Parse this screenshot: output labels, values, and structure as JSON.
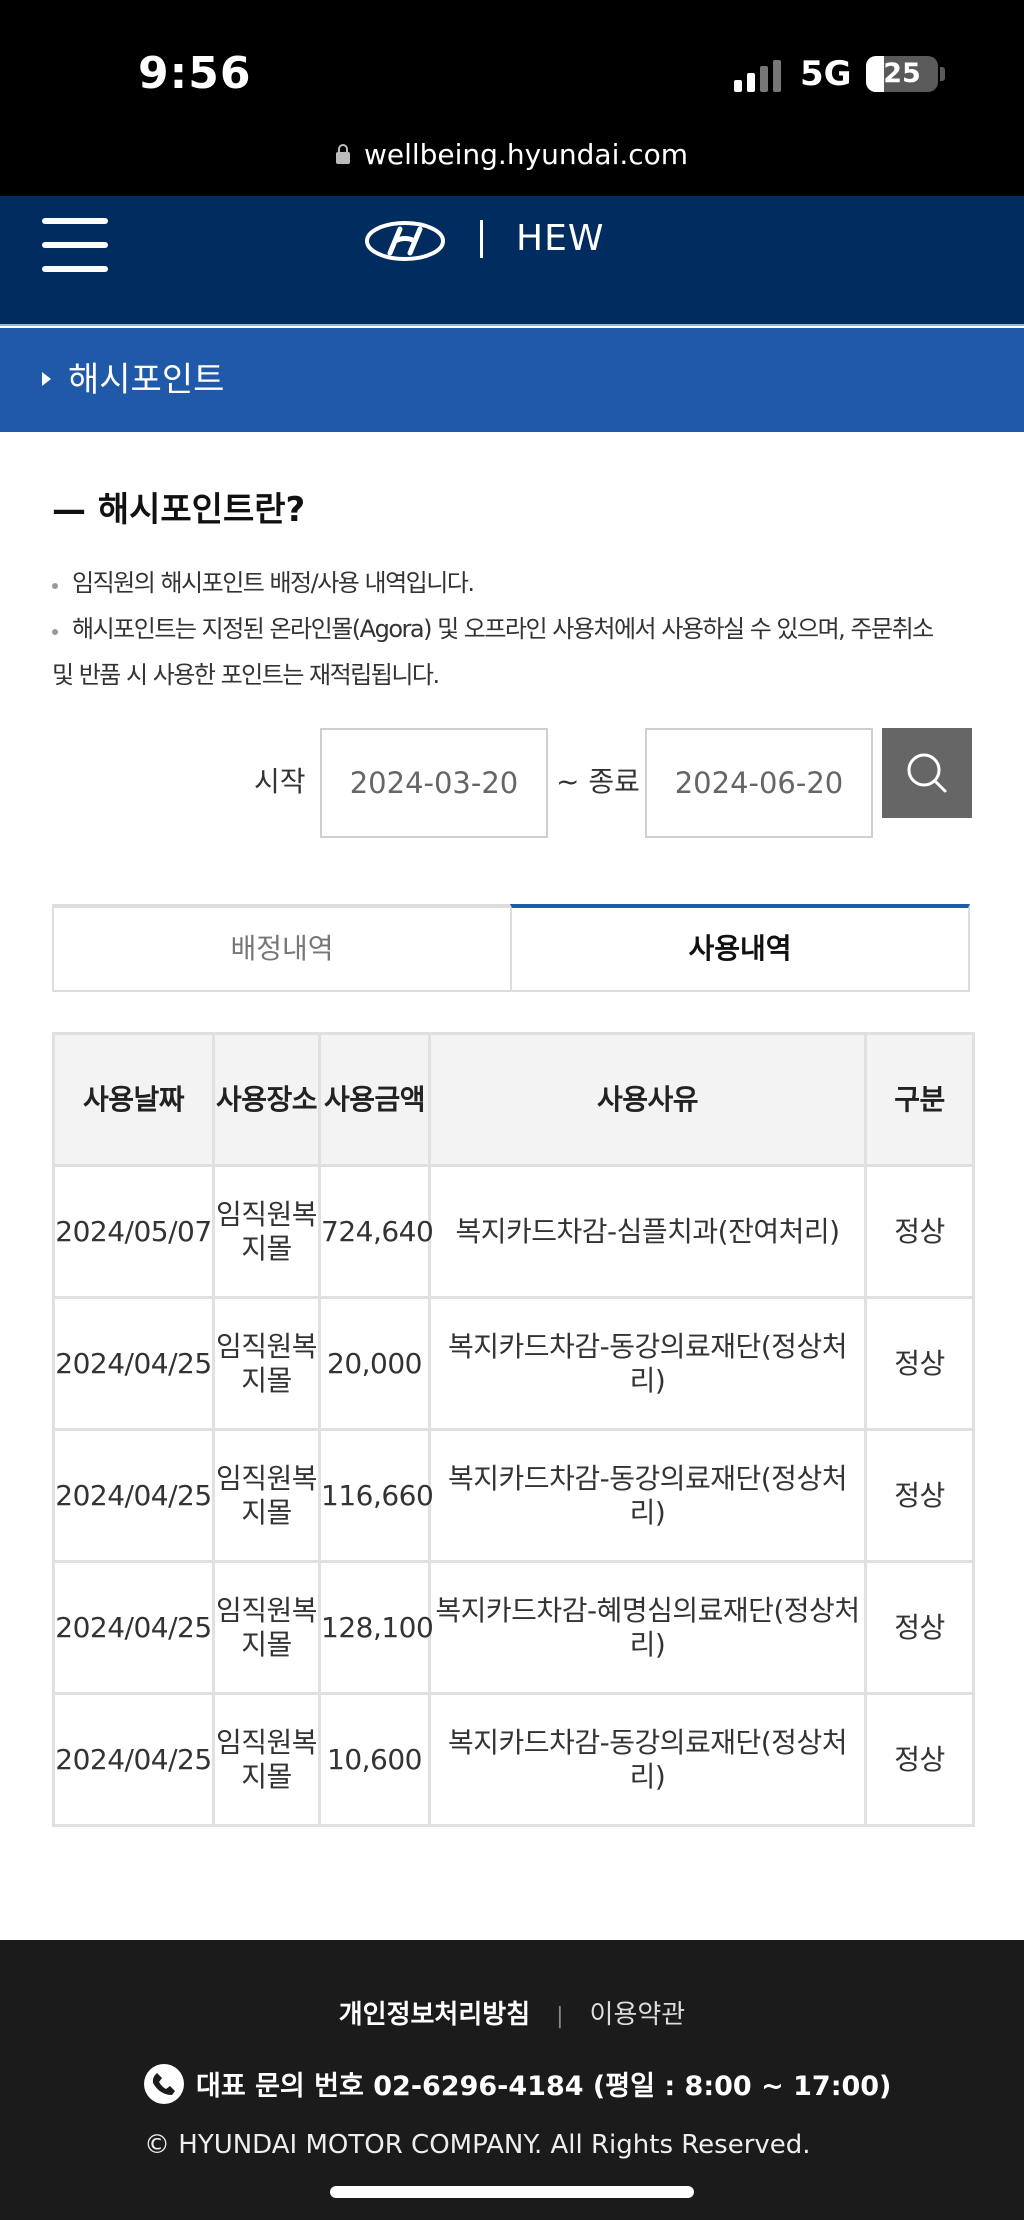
{
  "status_bar": {
    "time": "9:56",
    "network": "5G",
    "battery": "25",
    "battery_level": 0.25,
    "url": "wellbeing.hyundai.com",
    "icons": [
      "signal-icon",
      "battery-icon",
      "lock-icon"
    ]
  },
  "header": {
    "title": "HEW",
    "bg_color": "#002c5f",
    "icons": [
      "menu-icon",
      "hyundai-logo-icon"
    ]
  },
  "subnav": {
    "label": "해시포인트",
    "bg_color": "#1f59a8"
  },
  "intro": {
    "title": "— 해시포인트란?",
    "lines": [
      "임직원의 해시포인트 배정/사용 내역입니다.",
      "해시포인트는 지정된 온라인몰(Agora) 및 오프라인 사용처에서 사용하실 수 있으며, 주문취소",
      "및 반품 시 사용한 포인트는 재적립됩니다."
    ]
  },
  "date_filter": {
    "start_label": "시작",
    "start_value": "2024-03-20",
    "end_label": "~ 종료",
    "end_value": "2024-06-20",
    "search_icon": "search-icon"
  },
  "tabs": [
    {
      "label": "배정내역",
      "active": false
    },
    {
      "label": "사용내역",
      "active": true
    }
  ],
  "table": {
    "headers": [
      "사용날짜",
      "사용장소",
      "사용금액",
      "사용사유",
      "구분"
    ],
    "rows": [
      [
        "2024/05/07",
        "임직원복지몰",
        "724,640",
        "복지카드차감-심플치과(잔여처리)",
        "정상"
      ],
      [
        "2024/04/25",
        "임직원복지몰",
        "20,000",
        "복지카드차감-동강의료재단(정상처리)",
        "정상"
      ],
      [
        "2024/04/25",
        "임직원복지몰",
        "116,660",
        "복지카드차감-동강의료재단(정상처리)",
        "정상"
      ],
      [
        "2024/04/25",
        "임직원복지몰",
        "128,100",
        "복지카드차감-혜명심의료재단(정상처리)",
        "정상"
      ],
      [
        "2024/04/25",
        "임직원복지몰",
        "10,600",
        "복지카드차감-동강의료재단(정상처리)",
        "정상"
      ]
    ]
  },
  "footer": {
    "privacy": "개인정보처리방침",
    "separator": "|",
    "terms": "이용약관",
    "phone": "대표 문의 번호 02-6296-4184 (평일 : 8:00 ~ 17:00)",
    "copyright": "© HYUNDAI MOTOR COMPANY. All Rights Reserved.",
    "phone_icon": "phone-icon"
  }
}
